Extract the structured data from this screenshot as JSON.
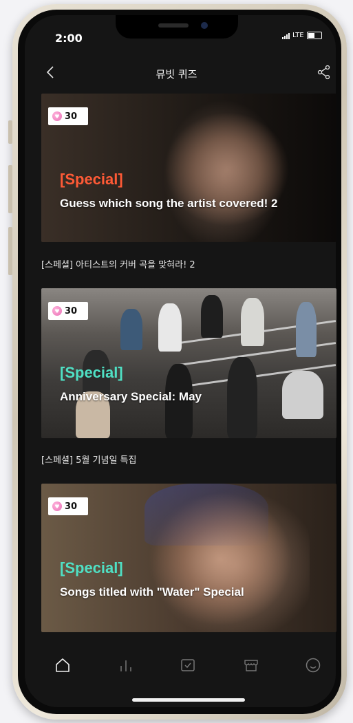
{
  "status_bar": {
    "time": "2:00",
    "network": "LTE"
  },
  "header": {
    "title": "뮤빗 퀴즈"
  },
  "colors": {
    "special_orange": "#ff5a36",
    "special_teal": "#4fe0c4",
    "background": "#151515"
  },
  "quizzes": [
    {
      "badge_count": "30",
      "tag": "[Special]",
      "title_en": "Guess which song the artist covered! 2",
      "caption_ko": "[스페셜] 아티스트의 커버 곡을 맞혀라! 2"
    },
    {
      "badge_count": "30",
      "tag": "[Special]",
      "title_en": "Anniversary Special: May",
      "caption_ko": "[스페셜] 5월 기념일 특집"
    },
    {
      "badge_count": "30",
      "tag": "[Special]",
      "title_en": "Songs titled with \"Water\" Special"
    }
  ],
  "tab_bar": {
    "icons": [
      "home-icon",
      "chart-icon",
      "quiz-check-icon",
      "store-icon",
      "profile-smile-icon"
    ]
  }
}
